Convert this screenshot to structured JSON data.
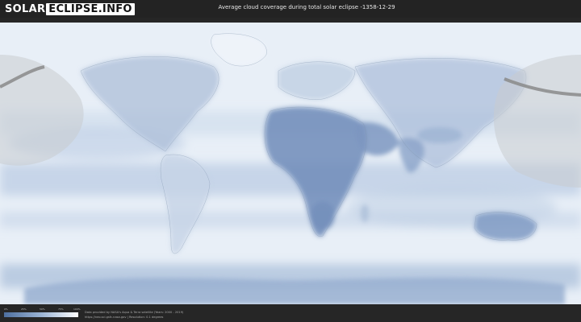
{
  "header": {
    "logo_solar": "SOLAR",
    "logo_rest": "ECLIPSE.INFO",
    "title": "Average cloud coverage during total solar eclipse -1358-12-29"
  },
  "legend": {
    "ticks": [
      "0%",
      "25%",
      "50%",
      "75%",
      "100%"
    ]
  },
  "footer": {
    "credit_line1": "Data provided by NASA's Aqua & Terra satellite (Years: 2000 - 2019)",
    "credit_line2": "https://neo.sci.gsfc.nasa.gov | Resolution: 0.1 degrees"
  },
  "colors": {
    "cloud_clear": "#4d6f9f",
    "cloud_mid": "#9bb4d4",
    "cloud_full": "#ffffff",
    "eclipse_path": "#8a8a8a",
    "night_overlay": "#c9ccd0"
  }
}
